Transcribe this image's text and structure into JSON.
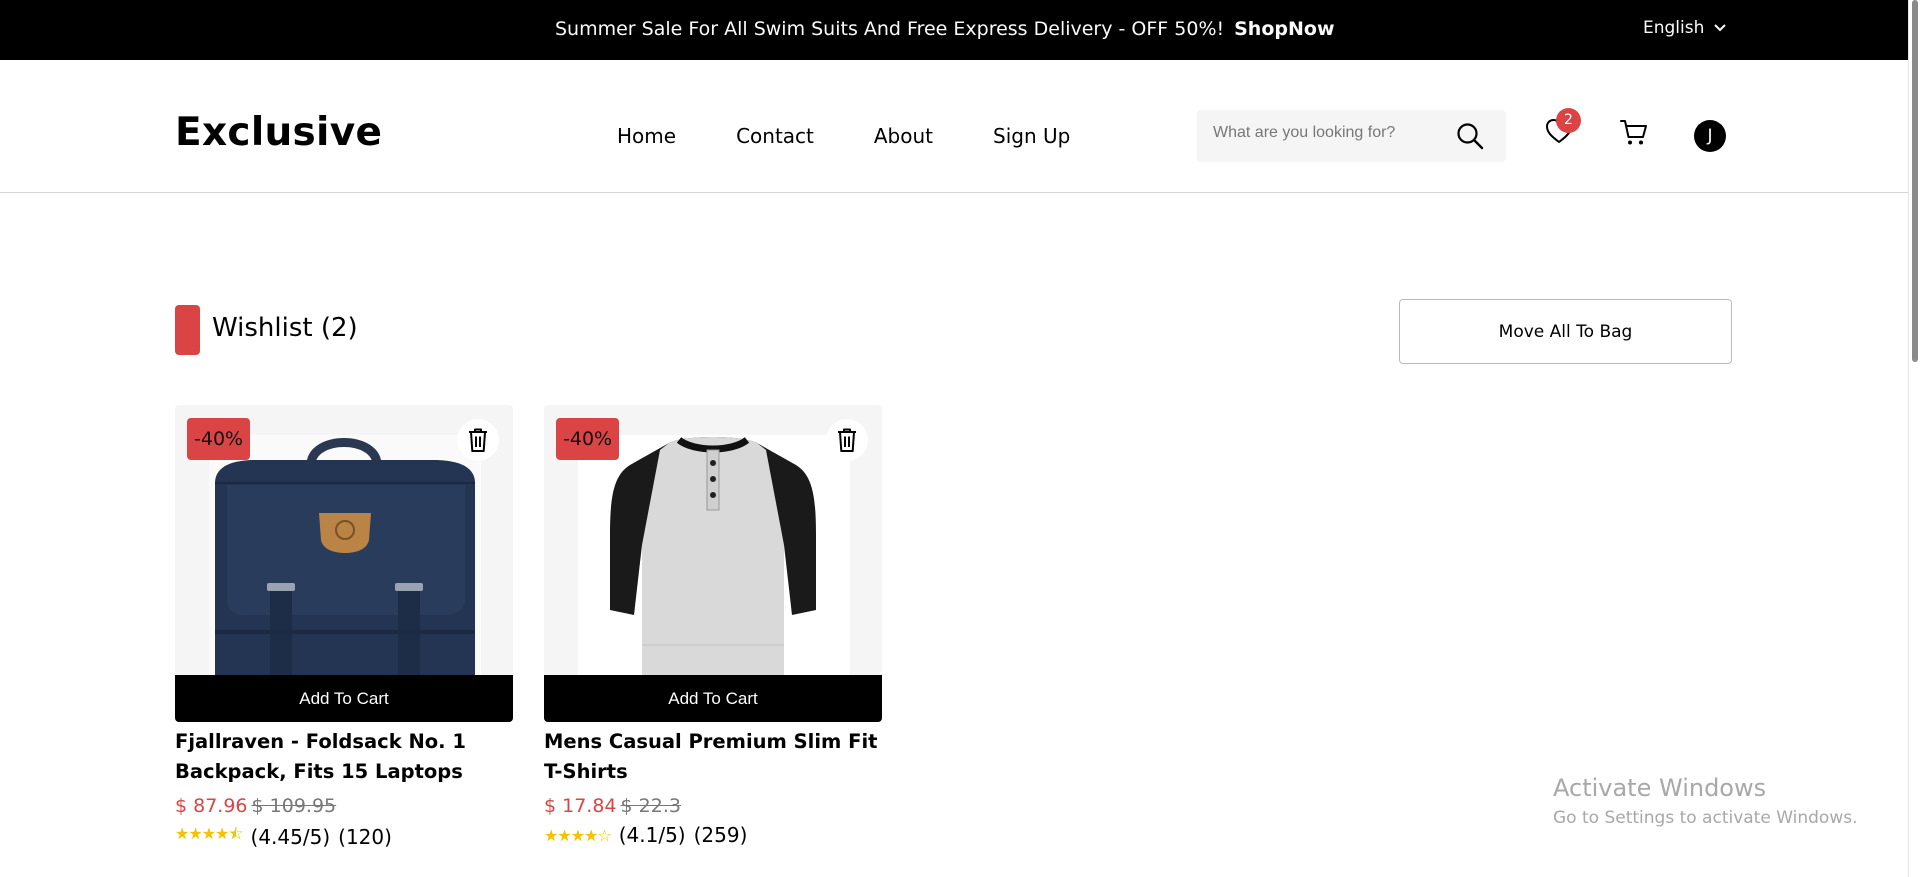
{
  "topbar": {
    "promo_text": "Summer Sale For All Swim Suits And Free Express Delivery - OFF 50%!",
    "shop_now": "ShopNow",
    "language": "English"
  },
  "header": {
    "logo": "Exclusive",
    "nav": [
      "Home",
      "Contact",
      "About",
      "Sign Up"
    ],
    "search_placeholder": "What are you looking for?",
    "wishlist_count": "2",
    "user_initial": "J"
  },
  "wishlist": {
    "title": "Wishlist (2)",
    "move_all_label": "Move All To Bag",
    "items": [
      {
        "discount": "-40%",
        "add_to_cart": "Add To Cart",
        "name": "Fjallraven - Foldsack No. 1 Backpack, Fits 15 Laptops",
        "price": "$ 87.96",
        "old_price": "$ 109.95",
        "rating_value": 4.45,
        "rating_text": "(4.45/5)",
        "review_count": "(120)",
        "image": "navy-backpack"
      },
      {
        "discount": "-40%",
        "add_to_cart": "Add To Cart",
        "name": "Mens Casual Premium Slim Fit T-Shirts",
        "price": "$ 17.84",
        "old_price": "$ 22.3",
        "rating_value": 4.1,
        "rating_text": "(4.1/5)",
        "review_count": "(259)",
        "image": "raglan-henley-shirt"
      }
    ]
  },
  "watermark": {
    "line1": "Activate Windows",
    "line2": "Go to Settings to activate Windows."
  },
  "colors": {
    "accent": "#db4444",
    "star": "#f4c300",
    "topbar": "#000000"
  }
}
